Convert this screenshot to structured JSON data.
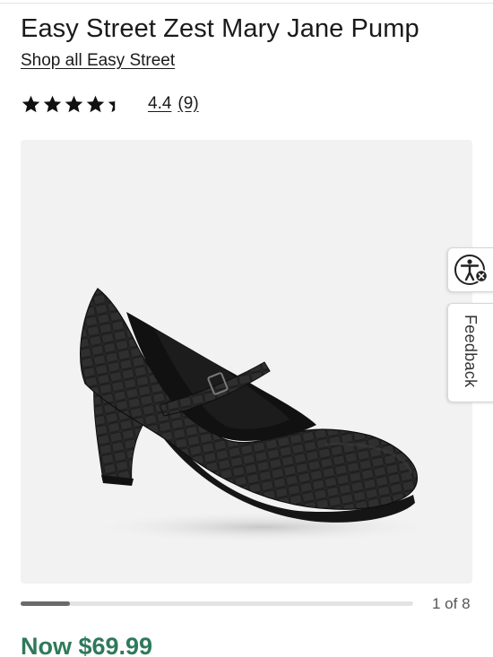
{
  "product": {
    "title": "Easy Street Zest Mary Jane Pump",
    "brand_link": "Shop all Easy Street",
    "rating": {
      "stars": 4.4,
      "value_label": "4.4",
      "count_label": "(9)"
    },
    "image": {
      "icon": "black-mary-jane-pump-shoe",
      "carousel_position": "1 of 8",
      "progress": 0.125
    },
    "price": "Now $69.99"
  },
  "widgets": {
    "accessibility_icon": "accessibility-icon",
    "feedback_label": "Feedback"
  },
  "colors": {
    "price_green": "#2e7a5a",
    "image_bg": "#f2f2f2",
    "progress_fill": "#6a6a6a"
  }
}
